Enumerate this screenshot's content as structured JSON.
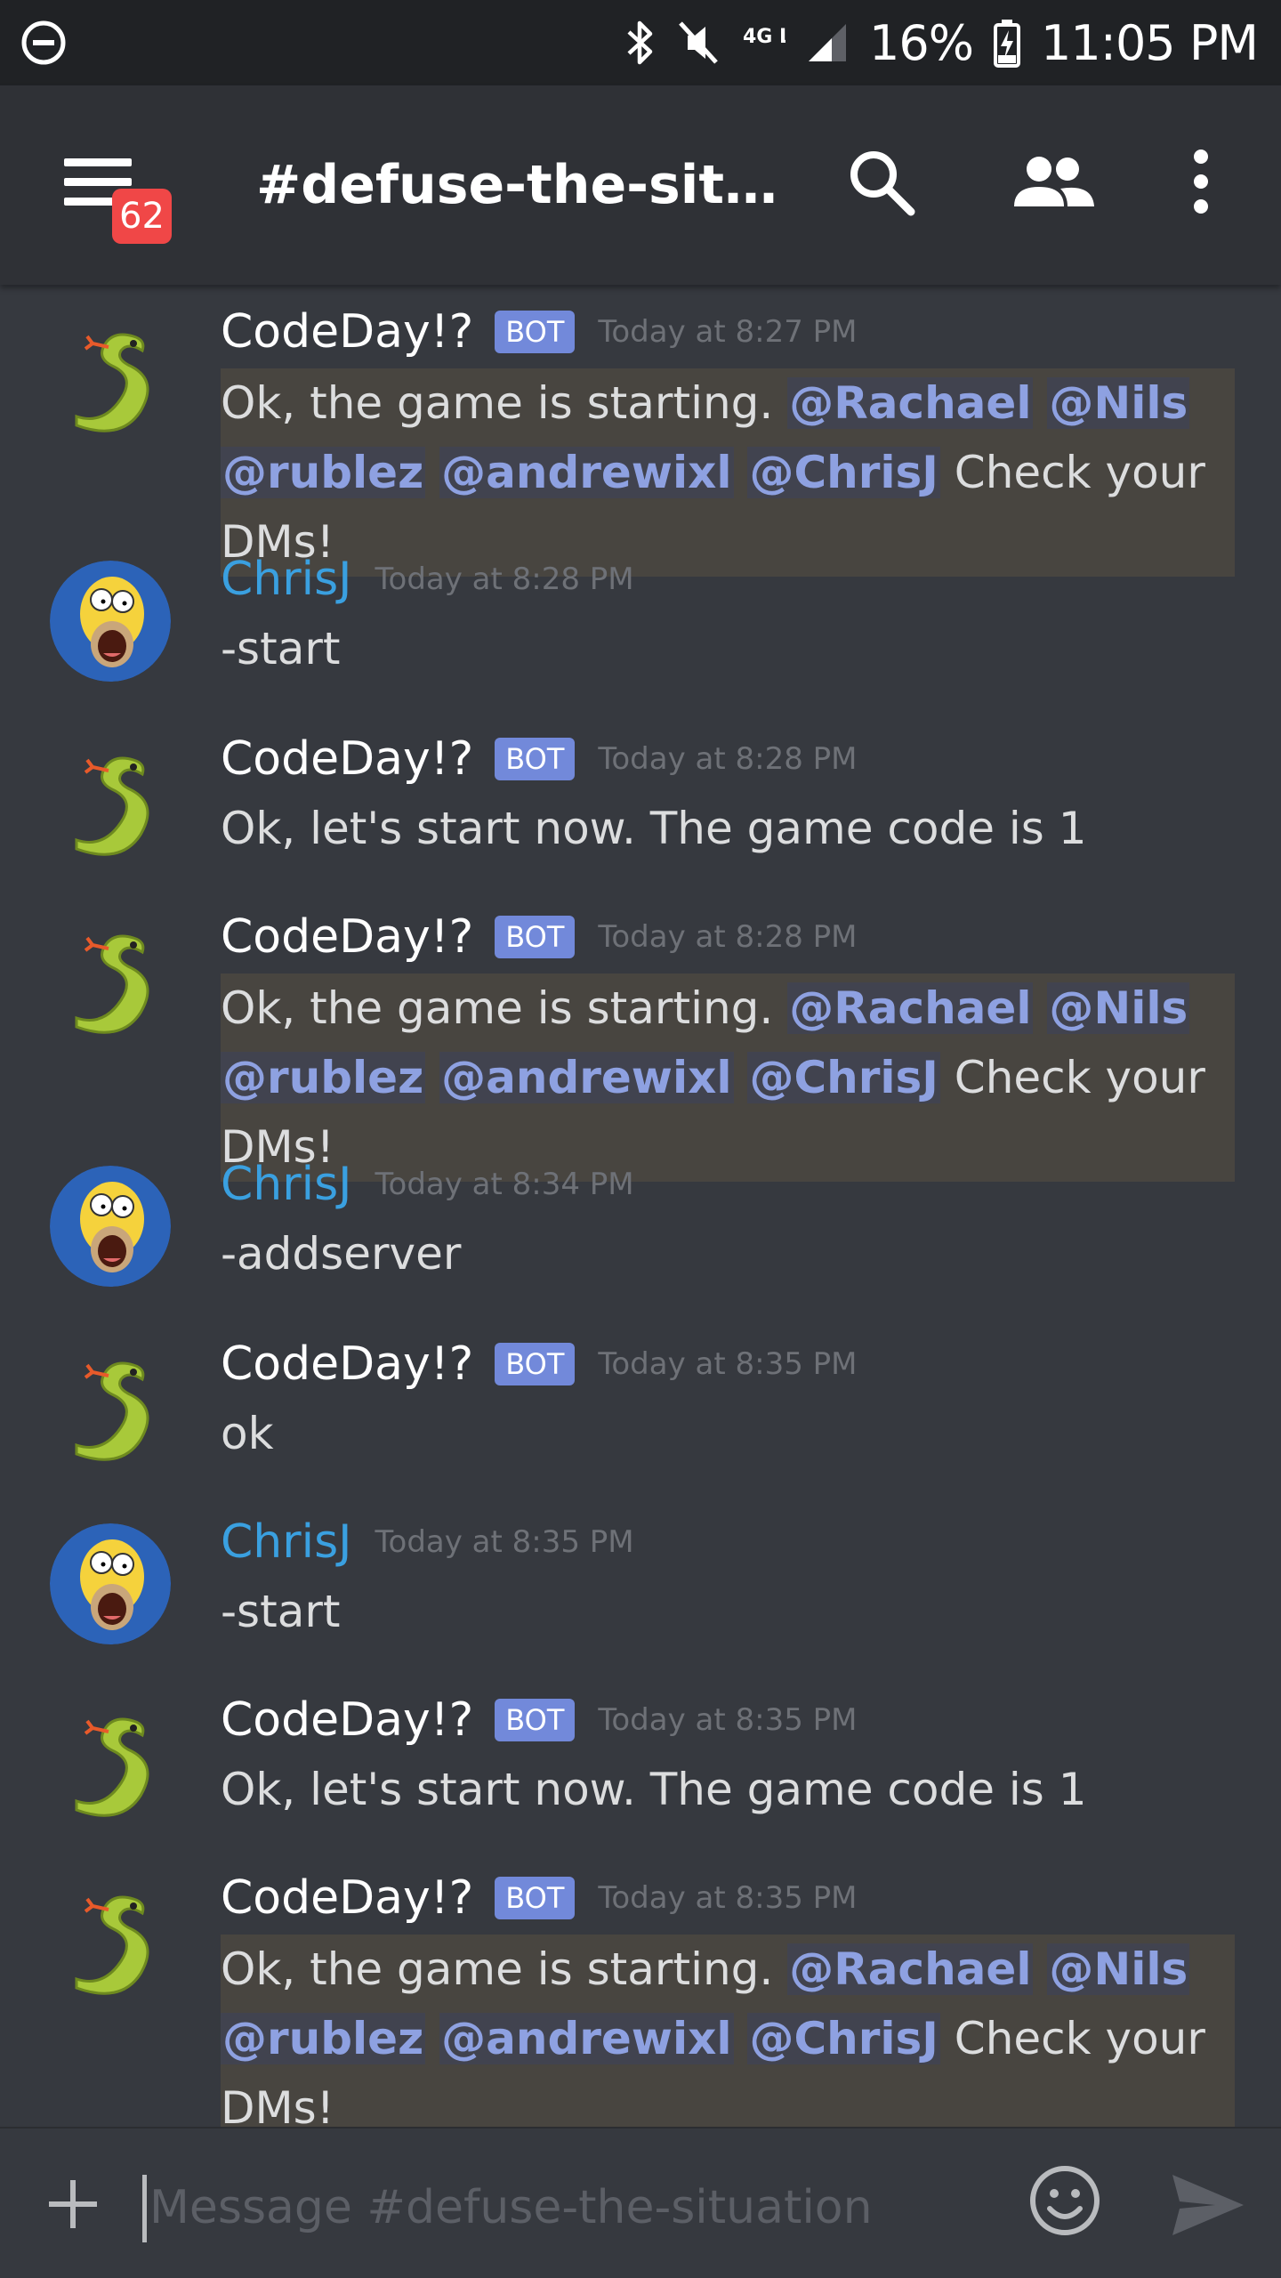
{
  "status_bar": {
    "network": "4G LTE",
    "battery": "16%",
    "time": "11:05 PM"
  },
  "header": {
    "unread_badge": "62",
    "channel_title": "#defuse-the-situa..."
  },
  "messages": [
    {
      "author": "CodeDay!?",
      "bot_tag": "BOT",
      "time": "Today at 8:27 PM",
      "text_before": "Ok, the game is starting. ",
      "mentions": [
        "@Rachael",
        "@Nils",
        "@rublez",
        "@andrewixl",
        "@ChrisJ"
      ],
      "text_after": " Check your DMs!"
    },
    {
      "author": "ChrisJ",
      "time": "Today at 8:28 PM",
      "text": "-start"
    },
    {
      "author": "CodeDay!?",
      "bot_tag": "BOT",
      "time": "Today at 8:28 PM",
      "text": "Ok, let's start now. The game code is 1"
    },
    {
      "author": "CodeDay!?",
      "bot_tag": "BOT",
      "time": "Today at 8:28 PM",
      "text_before": "Ok, the game is starting. ",
      "mentions": [
        "@Rachael",
        "@Nils",
        "@rublez",
        "@andrewixl",
        "@ChrisJ"
      ],
      "text_after": " Check your DMs!"
    },
    {
      "author": "ChrisJ",
      "time": "Today at 8:34 PM",
      "text": "-addserver"
    },
    {
      "author": "CodeDay!?",
      "bot_tag": "BOT",
      "time": "Today at 8:35 PM",
      "text": "ok"
    },
    {
      "author": "ChrisJ",
      "time": "Today at 8:35 PM",
      "text": "-start"
    },
    {
      "author": "CodeDay!?",
      "bot_tag": "BOT",
      "time": "Today at 8:35 PM",
      "text": "Ok, let's start now. The game code is 1"
    },
    {
      "author": "CodeDay!?",
      "bot_tag": "BOT",
      "time": "Today at 8:35 PM",
      "text_before": "Ok, the game is starting. ",
      "mentions": [
        "@Rachael",
        "@Nils",
        "@rublez",
        "@andrewixl",
        "@ChrisJ"
      ],
      "text_after": " Check your DMs!"
    }
  ],
  "composer": {
    "placeholder": "Message #defuse-the-situation"
  },
  "icons": {
    "dnd": "do-not-disturb-icon",
    "bluetooth": "bluetooth-icon",
    "mute": "muted-icon",
    "signal": "signal-icon",
    "battery": "battery-charging-icon",
    "menu": "hamburger-menu-icon",
    "search": "search-icon",
    "members": "members-icon",
    "overflow": "more-vertical-icon",
    "attach": "plus-icon",
    "emoji": "emoji-icon",
    "send": "send-icon"
  },
  "colors": {
    "background": "#36393f",
    "header": "#2f3136",
    "status_bar": "#202225",
    "bot_tag": "#7289da",
    "mention": "#8ea1e1",
    "chris_name": "#3aa0e0",
    "badge": "#f04747",
    "highlight": "#484540"
  }
}
